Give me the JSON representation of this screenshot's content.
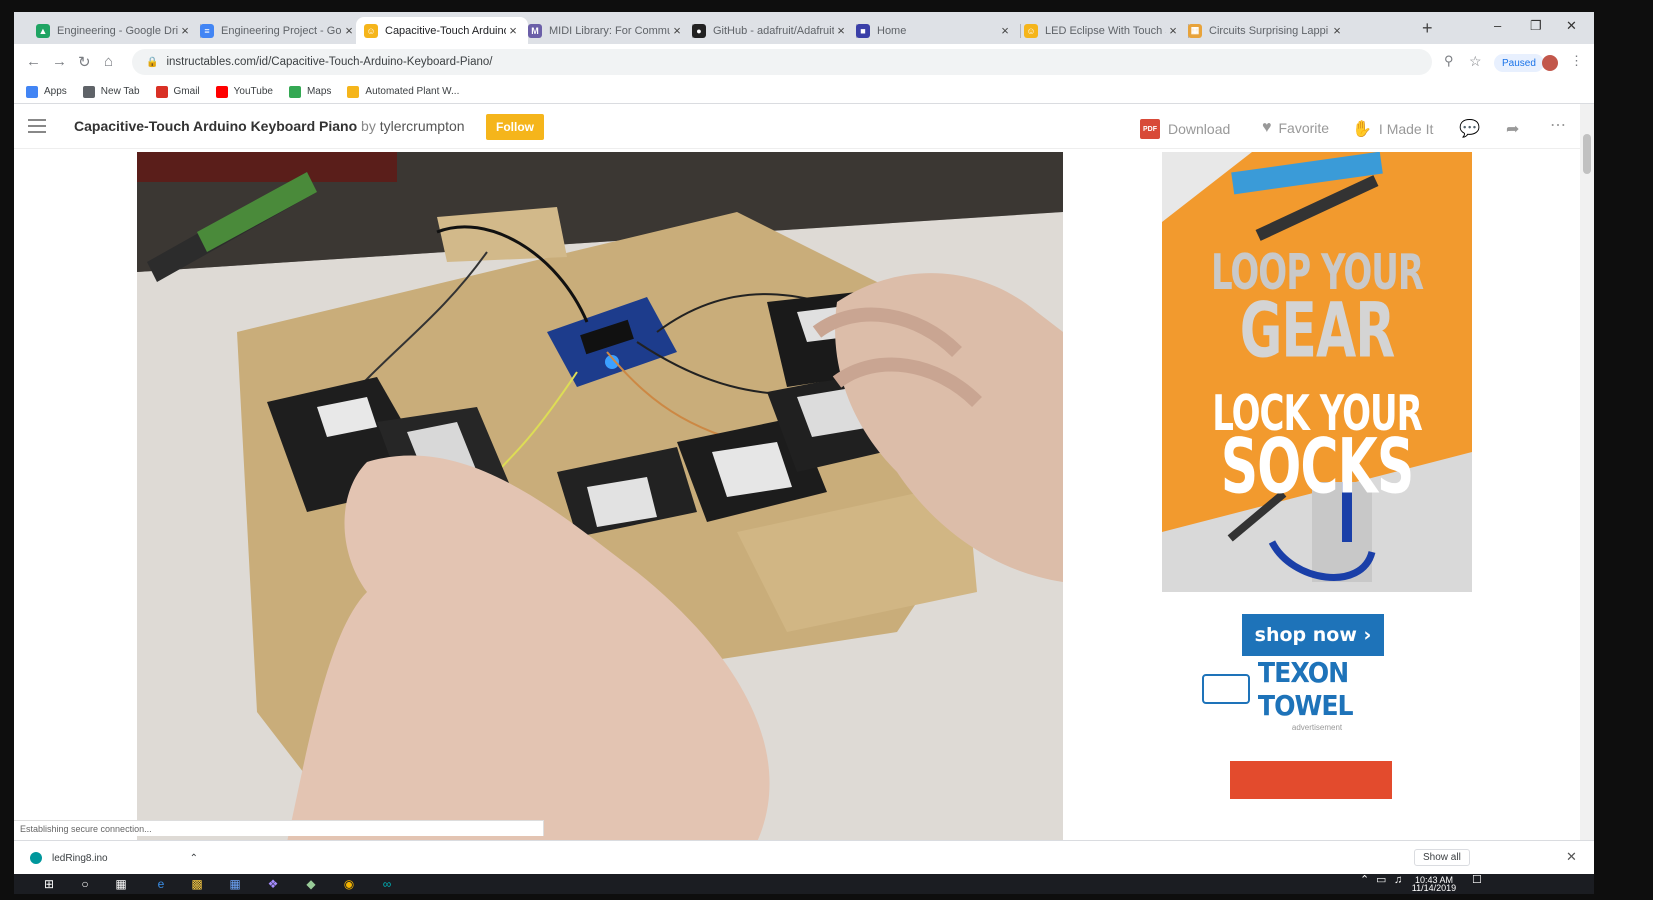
{
  "browser": {
    "tabs": [
      {
        "title": "Engineering - Google Drive",
        "favicon_color": "#1fa463",
        "glyph": "▲"
      },
      {
        "title": "Engineering Project - Google Docs",
        "favicon_color": "#4285f4",
        "glyph": "≡"
      },
      {
        "title": "Capacitive-Touch Arduino Keyboard Piano",
        "favicon_color": "#f5b51b",
        "glyph": "☺",
        "active": true
      },
      {
        "title": "MIDI Library: For Communicating",
        "favicon_color": "#6b5fa8",
        "glyph": "M"
      },
      {
        "title": "GitHub - adafruit/Adafruit",
        "favicon_color": "#222222",
        "glyph": "●"
      },
      {
        "title": "Home",
        "favicon_color": "#3a3fa8",
        "glyph": "■"
      },
      {
        "title": "LED Eclipse With Touch Sensor",
        "favicon_color": "#f5b51b",
        "glyph": "☺"
      },
      {
        "title": "Circuits Surprising Lappi | T",
        "favicon_color": "#e8a33a",
        "glyph": "▦"
      }
    ],
    "new_tab_glyph": "+",
    "url": "instructables.com/id/Capacitive-Touch-Arduino-Keyboard-Piano/",
    "profile_label": "Paused",
    "bookmarks": [
      {
        "label": "Apps",
        "color": "#4285f4"
      },
      {
        "label": "New Tab",
        "color": "#5f6368"
      },
      {
        "label": "Gmail",
        "color": "#d93025"
      },
      {
        "label": "YouTube",
        "color": "#ff0000"
      },
      {
        "label": "Maps",
        "color": "#34a853"
      },
      {
        "label": "Automated Plant W...",
        "color": "#f5b51b"
      }
    ]
  },
  "page": {
    "title": "Capacitive-Touch Arduino Keyboard Piano",
    "by": "by",
    "author": "tylercrumpton",
    "follow_label": "Follow",
    "actions": {
      "download": "Download",
      "favorite": "Favorite",
      "made_it": "I Made It",
      "pdf_badge": "PDF"
    }
  },
  "ad": {
    "line1": "LOOP YOUR",
    "line2": "GEAR",
    "line3": "LOCK YOUR",
    "line4": "SOCKS",
    "cta": "shop now ›",
    "brand": "TEXON TOWEL",
    "note": "advertisement",
    "colors": {
      "orange": "#f29a2e",
      "blue": "#1e73b9",
      "red": "#e34b2d"
    }
  },
  "status_text": "Establishing secure connection...",
  "download_shelf": {
    "file": "ledRing8.ino",
    "show_all": "Show all"
  },
  "taskbar": {
    "time": "10:43 AM",
    "date": "11/14/2019"
  }
}
